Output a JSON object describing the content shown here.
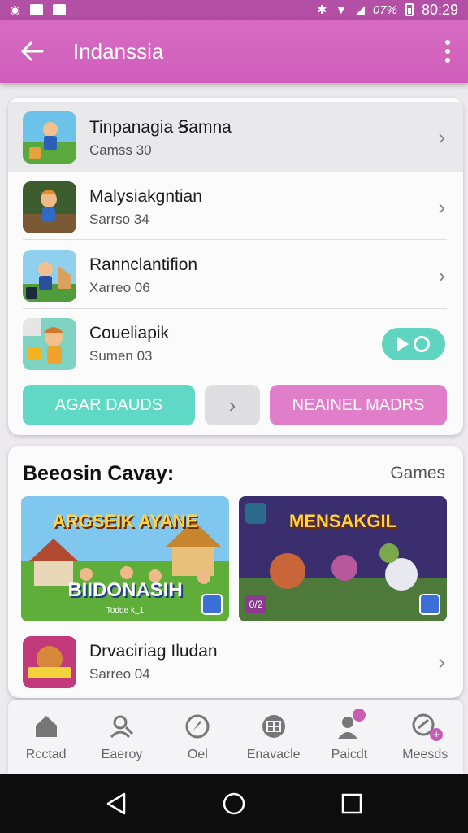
{
  "status_bar": {
    "battery_text": "07%",
    "time": "80:29"
  },
  "app_bar": {
    "title": "Indanssia"
  },
  "list": [
    {
      "name": "Tinpanagia Ꞩamna",
      "sub": "Camss 30",
      "highlighted": true,
      "action": "chevron"
    },
    {
      "name": "Malysiakgntian",
      "sub": "Sarrso 34",
      "highlighted": false,
      "action": "chevron"
    },
    {
      "name": "Rannclantifion",
      "sub": "Xarreo 06",
      "highlighted": false,
      "action": "chevron"
    },
    {
      "name": "Coueliapik",
      "sub": "Sumen 03",
      "highlighted": false,
      "action": "play"
    }
  ],
  "buttons": {
    "left": "AGAR DAUDS",
    "right": "NEAINEL MADRS"
  },
  "section": {
    "title": "Beeosin Cavay:",
    "more": "Games",
    "banners": [
      {
        "title": "ARGSEIK AYANE",
        "subtitle": "BIIDONASIH",
        "badge": "",
        "tag": "Todde k_1"
      },
      {
        "title": "MENSAKGIL",
        "subtitle": "",
        "badge": "0/2",
        "tag": ""
      }
    ],
    "item": {
      "name": "Drvaciriag Iludan",
      "sub": "Sarreo 04"
    }
  },
  "bottom_nav": [
    {
      "label": "Rcctad",
      "icon": "home-icon"
    },
    {
      "label": "Eaeroy",
      "icon": "person-search-icon"
    },
    {
      "label": "Oel",
      "icon": "compass-icon"
    },
    {
      "label": "Enavacle",
      "icon": "grid-icon"
    },
    {
      "label": "Paicdt",
      "icon": "profile-icon"
    },
    {
      "label": "Meesds",
      "icon": "badge-icon"
    }
  ],
  "colors": {
    "accent_pink": "#d76bc2",
    "accent_teal": "#5fd9c5",
    "button_pink": "#e07ec9"
  }
}
